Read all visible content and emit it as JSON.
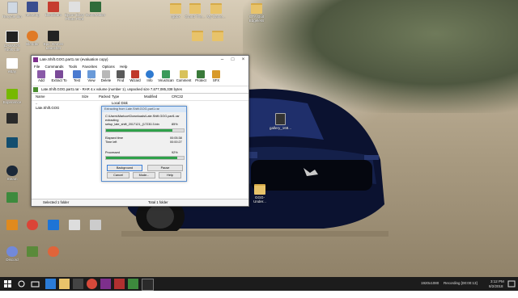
{
  "desktop": {
    "icons_left": [
      {
        "label": "Recycle Bin"
      },
      {
        "label": "netsetng"
      },
      {
        "label": "Bandicam"
      },
      {
        "label": "Epson Easy Photo Print"
      },
      {
        "label": "GameMaker"
      },
      {
        "label": "Blender"
      },
      {
        "label": "Epic Games Launcher"
      },
      {
        "label": "DAEMON Tools Lite"
      },
      {
        "label": "eBay"
      },
      {
        "label": "Experience"
      },
      {
        "label": "Steam"
      },
      {
        "label": "Discord"
      }
    ],
    "icons_top": [
      {
        "label": "rgdox"
      },
      {
        "label": "Grand The..."
      },
      {
        "label": "My Game..."
      },
      {
        "label": "GTA Quit Edgeless"
      }
    ],
    "icon_gallery": "gallery_168...",
    "icon_right_folder": "GGG-Under..."
  },
  "winrar": {
    "title": "Late.Shift.GOG.part1.rar (evaluation copy)",
    "menu": [
      "File",
      "Commands",
      "Tools",
      "Favorites",
      "Options",
      "Help"
    ],
    "toolbar": [
      "Add",
      "Extract To",
      "Test",
      "View",
      "Delete",
      "Find",
      "Wizard",
      "Info",
      "VirusScan",
      "Comment",
      "Protect",
      "SFX"
    ],
    "path": "Late.Shift.GOG.part1.rar - RAR 4.x volume (number 1), unpacked size 7,677,085,338 bytes",
    "columns": [
      "Name",
      "Size",
      "Packed",
      "Type",
      "Modified",
      "CRC32"
    ],
    "rows": [
      {
        "name": "..",
        "type": "Local Disk"
      },
      {
        "name": "Late.Shift.GOG",
        "type": "File folder",
        "modified": "1/1/2018 8:28"
      }
    ],
    "status_left": "Selected 1 folder",
    "status_right": "Total 1 folder"
  },
  "extract_dialog": {
    "title": "Extracting from Late.Shift.GOG.part1.rar",
    "path": "C:\\Users\\Marluce\\Downloads\\Late.Shift.GOG.part1.rar",
    "action": "extracting",
    "file": "setup_late_shift_2017121_(17230.3.bin",
    "file_percent": "85%",
    "elapsed_label": "Elapsed time",
    "elapsed_value": "00:05:38",
    "left_label": "Time left",
    "left_value": "00:00:27",
    "processed_label": "Processed",
    "processed_percent": "92%",
    "file_fraction": 0.85,
    "processed_fraction": 0.92,
    "buttons": [
      "Background",
      "Pause",
      "Cancel",
      "Mode...",
      "Help"
    ]
  },
  "taskbar": {
    "resolution": "1920x1080",
    "recording": "Recording [00:00:13]",
    "time": "3:12 PM",
    "date": "8/2/2018"
  }
}
